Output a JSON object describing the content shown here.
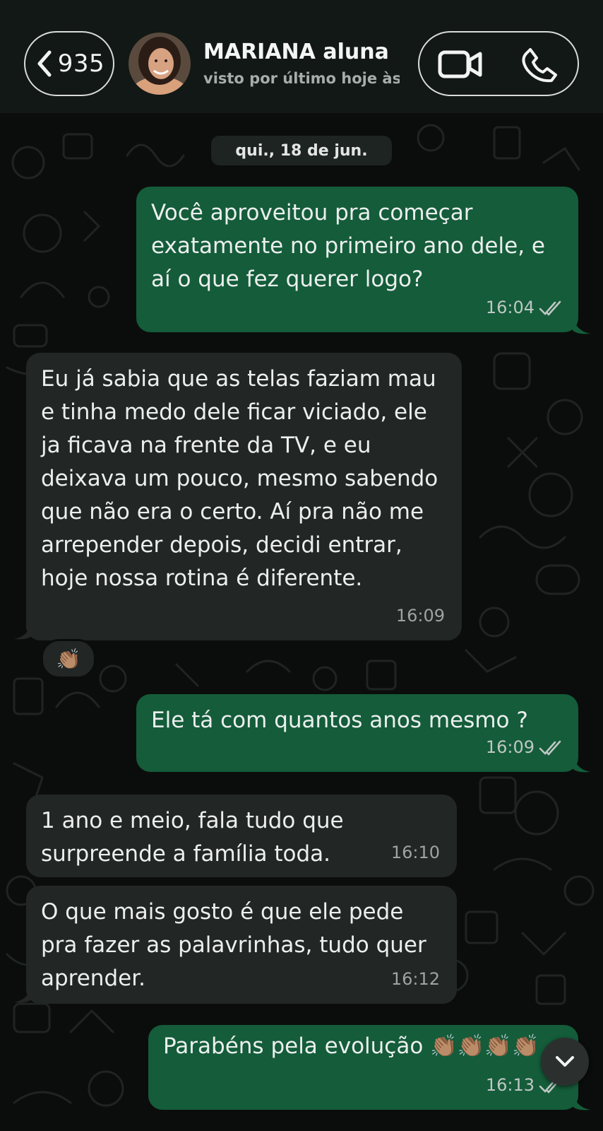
{
  "header": {
    "back_count": "935",
    "contact_name": "MARIANA aluna",
    "status": "visto por último hoje às"
  },
  "date_separator": "qui., 18 de jun.",
  "messages": [
    {
      "direction": "out",
      "text": "Você aproveitou pra começar exatamente no primeiro ano dele, e aí o que fez querer logo?",
      "time": "16:04",
      "read": true
    },
    {
      "direction": "in",
      "text": "Eu já sabia que as telas faziam mau e tinha medo dele ficar viciado,  ele ja ficava na frente da TV, e eu deixava um pouco, mesmo sabendo que não era o certo. Aí pra não me arrepender depois, decidi entrar, hoje nossa rotina é diferente.",
      "time": "16:09",
      "reaction": "👏🏽"
    },
    {
      "direction": "out",
      "text": "Ele tá com quantos anos mesmo ?",
      "time": "16:09",
      "read": true
    },
    {
      "direction": "in",
      "text": "1 ano e meio, fala tudo que surpreende a família toda.",
      "time": "16:10"
    },
    {
      "direction": "in",
      "text": "O que mais gosto é que ele pede pra fazer as palavrinhas, tudo quer aprender.",
      "time": "16:12"
    },
    {
      "direction": "out",
      "text": "Parabéns pela evolução 👏🏽👏🏽👏🏽👏🏽",
      "time": "16:13",
      "read": true
    }
  ],
  "icons": {
    "back": "chevron-left-icon",
    "video": "video-camera-icon",
    "call": "phone-icon",
    "read": "double-check-icon",
    "scroll": "chevron-down-icon"
  },
  "colors": {
    "outgoing_bubble": "#145c3a",
    "incoming_bubble": "#222624",
    "background": "#0b0d0c"
  }
}
